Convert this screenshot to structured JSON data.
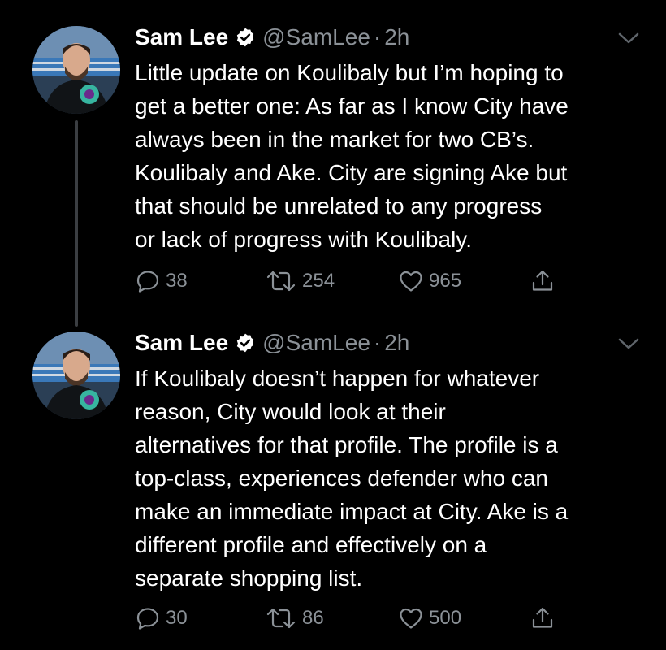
{
  "tweets": [
    {
      "author": {
        "display_name": "Sam Lee",
        "handle": "@SamLee",
        "verified": true,
        "avatar_icon": "avatar-photo"
      },
      "time": "2h",
      "text": "Little update on Koulibaly but I’m hoping to\nget a better one: As far as I know City have\nalways been in the market for two CB’s.\nKoulibaly and Ake. City are signing Ake but\nthat should be unrelated to any progress\nor lack of progress with Koulibaly.",
      "replies": "38",
      "retweets": "254",
      "likes": "965"
    },
    {
      "author": {
        "display_name": "Sam Lee",
        "handle": "@SamLee",
        "verified": true,
        "avatar_icon": "avatar-photo"
      },
      "time": "2h",
      "text": "If Koulibaly doesn’t happen for whatever\nreason, City would look at their\nalternatives for that profile. The profile is a\ntop-class, experiences defender who can\nmake an immediate impact at City. Ake is a\ndifferent profile and effectively on a\nseparate shopping list.",
      "replies": "30",
      "retweets": "86",
      "likes": "500"
    }
  ],
  "separator": "·",
  "colors": {
    "background": "#000000",
    "text": "#ffffff",
    "secondary": "#8b9197",
    "thread_line": "#3b3e42"
  }
}
